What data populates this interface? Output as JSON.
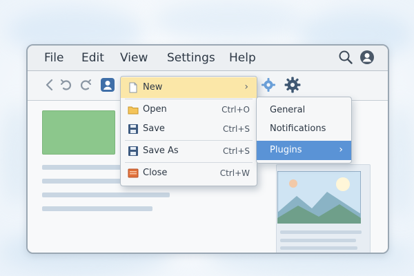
{
  "menubar": {
    "items": [
      {
        "label": "File"
      },
      {
        "label": "Edit"
      },
      {
        "label": "View"
      },
      {
        "label": "Settings"
      },
      {
        "label": "Help"
      }
    ],
    "icons": [
      "search-icon",
      "user-icon"
    ]
  },
  "toolbar": {
    "icons": [
      "back-icon",
      "undo-icon",
      "redo-icon",
      "user-badge-icon",
      "gear-icon",
      "gear-icon"
    ]
  },
  "file_menu": {
    "items": [
      {
        "label": "New",
        "shortcut": "",
        "has_submenu": true,
        "highlighted": true,
        "icon": "document-icon"
      },
      {
        "label": "Open",
        "shortcut": "Ctrl+O",
        "icon": "folder-icon"
      },
      {
        "label": "Save",
        "shortcut": "Ctrl+S",
        "icon": "floppy-disk-icon"
      },
      {
        "label": "Save As",
        "shortcut": "Ctrl+S",
        "icon": "floppy-disk-icon"
      },
      {
        "label": "Close",
        "shortcut": "Ctrl+W",
        "icon": "close-document-icon"
      }
    ]
  },
  "submenu": {
    "items": [
      {
        "label": "General"
      },
      {
        "label": "Notifications"
      },
      {
        "label": "Plugins",
        "highlighted": true,
        "has_submenu": true
      }
    ]
  },
  "colors": {
    "highlight_yellow": "#fbe7a8",
    "highlight_blue": "#5a93d6",
    "green_block": "#8cc78c",
    "placeholder_line": "#c9d6e2"
  }
}
